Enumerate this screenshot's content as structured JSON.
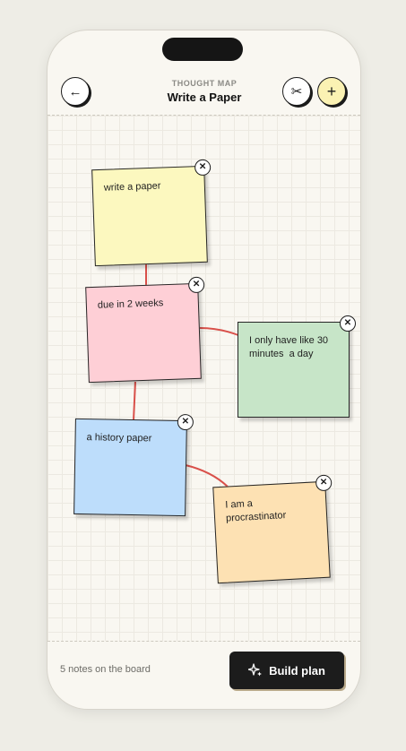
{
  "header": {
    "eyebrow": "THOUGHT MAP",
    "title": "Write a Paper",
    "back_icon": "←",
    "scissors_icon": "✂",
    "add_icon": "+"
  },
  "notes": [
    {
      "text": "write a paper",
      "color": "#fcf8bf"
    },
    {
      "text": "due in 2 weeks",
      "color": "#fecfd6"
    },
    {
      "text": "I only have like 30\nminutes  a day",
      "color": "#c7e5c8"
    },
    {
      "text": "a history paper",
      "color": "#bdddfb"
    },
    {
      "text": "I am a\nprocrastinator",
      "color": "#fde1b3"
    }
  ],
  "close_icon": "✕",
  "connector_color": "#d9504a",
  "footer": {
    "count_text": "5 notes on the board",
    "build_label": "Build plan"
  }
}
